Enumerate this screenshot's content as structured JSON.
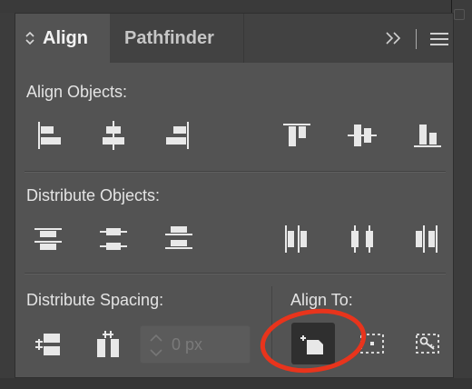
{
  "panel": {
    "tabs": [
      {
        "label": "Align",
        "active": true
      },
      {
        "label": "Pathfinder",
        "active": false
      }
    ],
    "icons": {
      "collapse": "double-chevron-right-icon",
      "menu": "hamburger-menu-icon"
    }
  },
  "align_objects": {
    "label": "Align Objects:",
    "buttons": [
      "horizontal-align-left-icon",
      "horizontal-align-center-icon",
      "horizontal-align-right-icon",
      "vertical-align-top-icon",
      "vertical-align-center-icon",
      "vertical-align-bottom-icon"
    ]
  },
  "distribute_objects": {
    "label": "Distribute Objects:",
    "buttons": [
      "vertical-distribute-top-icon",
      "vertical-distribute-center-icon",
      "vertical-distribute-bottom-icon",
      "horizontal-distribute-left-icon",
      "horizontal-distribute-center-icon",
      "horizontal-distribute-right-icon"
    ]
  },
  "distribute_spacing": {
    "label": "Distribute Spacing:",
    "buttons": [
      "vertical-distribute-space-icon",
      "horizontal-distribute-space-icon"
    ],
    "spacing_placeholder": "0 px"
  },
  "align_to": {
    "label": "Align To:",
    "buttons": [
      "align-to-artboard-icon",
      "align-to-selection-icon",
      "align-to-key-object-icon"
    ],
    "selected": "align-to-artboard-icon"
  },
  "colors": {
    "panel_bg": "#535353",
    "tabbar_bg": "#424242",
    "icon": "#e8e8e8",
    "highlight": "#e8341c"
  }
}
